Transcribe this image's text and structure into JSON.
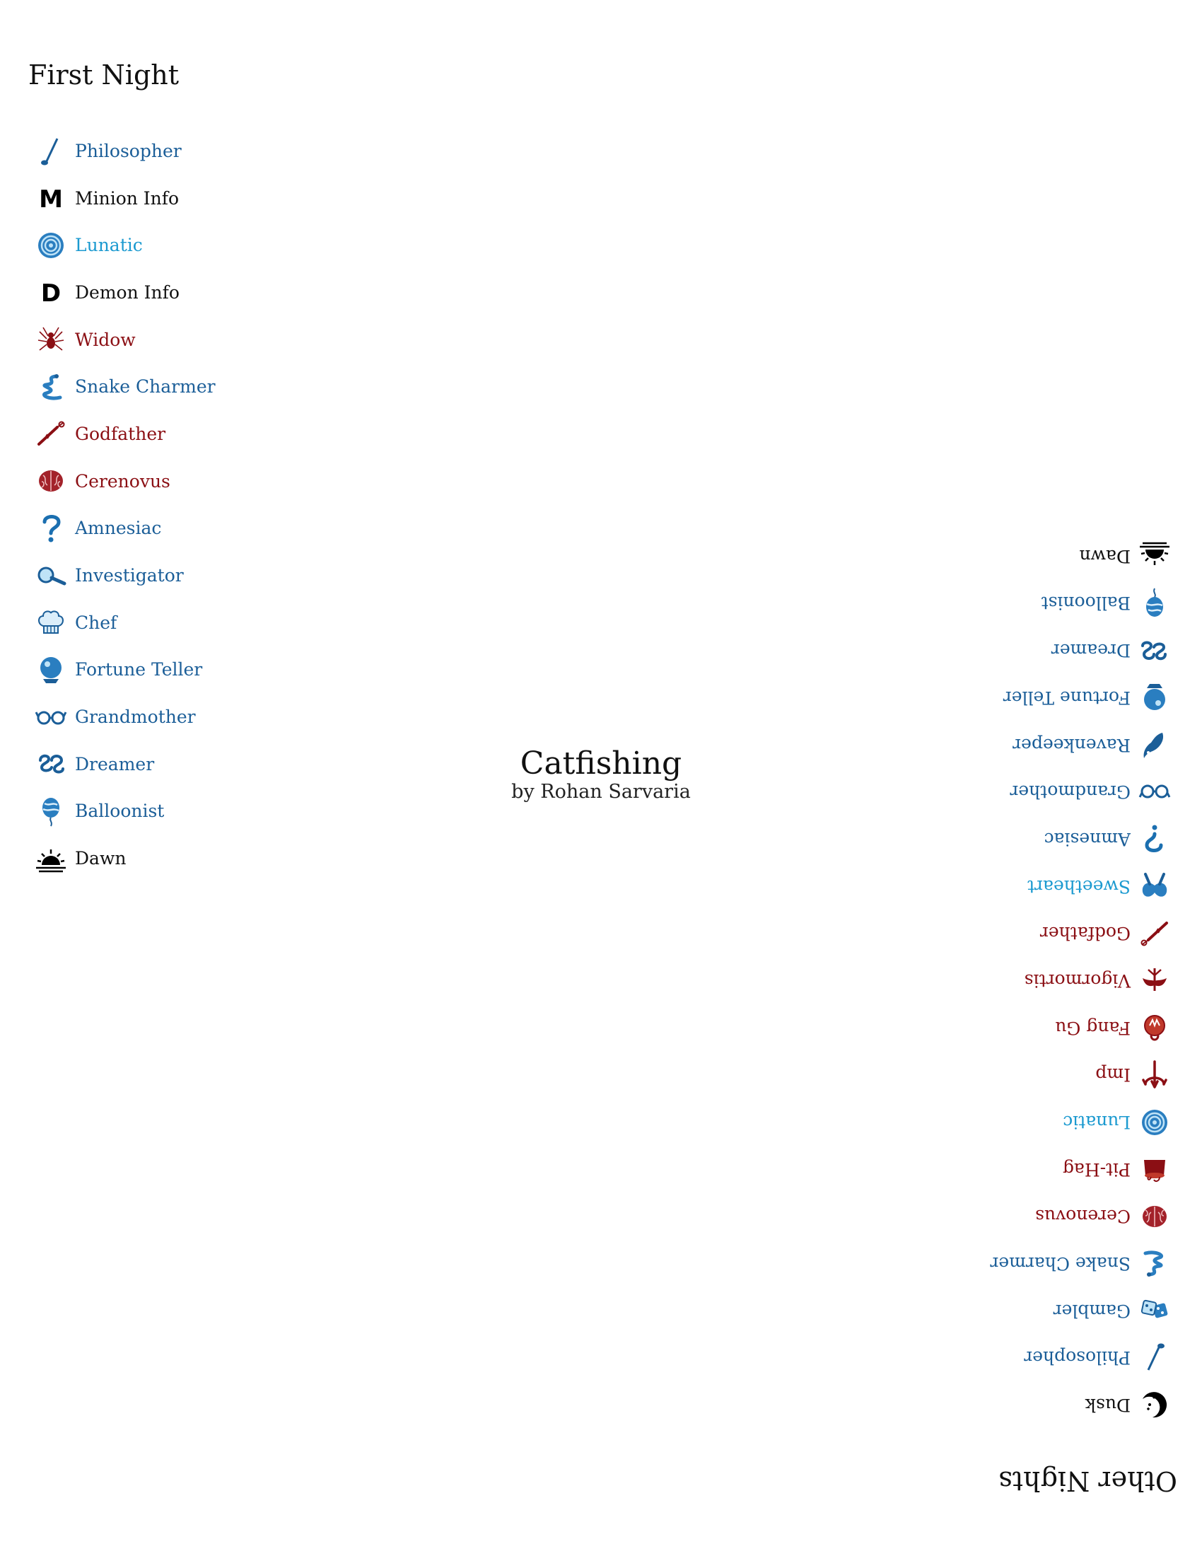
{
  "script": {
    "title": "Catfishing",
    "author": "by Rohan Sarvaria"
  },
  "first_night": {
    "title": "First Night",
    "items": [
      {
        "label": "Philosopher",
        "type": "townsfolk",
        "icon": "philosopher-icon"
      },
      {
        "label": "Minion Info",
        "type": "info",
        "icon": "minion-info-icon"
      },
      {
        "label": "Lunatic",
        "type": "outsider",
        "icon": "lunatic-icon"
      },
      {
        "label": "Demon Info",
        "type": "info",
        "icon": "demon-info-icon"
      },
      {
        "label": "Widow",
        "type": "minion",
        "icon": "widow-icon"
      },
      {
        "label": "Snake Charmer",
        "type": "townsfolk",
        "icon": "snake-charmer-icon"
      },
      {
        "label": "Godfather",
        "type": "minion",
        "icon": "godfather-icon"
      },
      {
        "label": "Cerenovus",
        "type": "minion",
        "icon": "cerenovus-icon"
      },
      {
        "label": "Amnesiac",
        "type": "townsfolk",
        "icon": "amnesiac-icon"
      },
      {
        "label": "Investigator",
        "type": "townsfolk",
        "icon": "investigator-icon"
      },
      {
        "label": "Chef",
        "type": "townsfolk",
        "icon": "chef-icon"
      },
      {
        "label": "Fortune Teller",
        "type": "townsfolk",
        "icon": "fortune-teller-icon"
      },
      {
        "label": "Grandmother",
        "type": "townsfolk",
        "icon": "grandmother-icon"
      },
      {
        "label": "Dreamer",
        "type": "townsfolk",
        "icon": "dreamer-icon"
      },
      {
        "label": "Balloonist",
        "type": "townsfolk",
        "icon": "balloonist-icon"
      },
      {
        "label": "Dawn",
        "type": "info",
        "icon": "dawn-icon"
      }
    ]
  },
  "other_nights": {
    "title": "Other Nights",
    "items": [
      {
        "label": "Dusk",
        "type": "info",
        "icon": "dusk-icon"
      },
      {
        "label": "Philosopher",
        "type": "townsfolk",
        "icon": "philosopher-icon"
      },
      {
        "label": "Gambler",
        "type": "townsfolk",
        "icon": "gambler-icon"
      },
      {
        "label": "Snake Charmer",
        "type": "townsfolk",
        "icon": "snake-charmer-icon"
      },
      {
        "label": "Cerenovus",
        "type": "minion",
        "icon": "cerenovus-icon"
      },
      {
        "label": "Pit-Hag",
        "type": "minion",
        "icon": "pit-hag-icon"
      },
      {
        "label": "Lunatic",
        "type": "outsider",
        "icon": "lunatic-icon"
      },
      {
        "label": "Imp",
        "type": "demon",
        "icon": "imp-icon"
      },
      {
        "label": "Fang Gu",
        "type": "demon",
        "icon": "fang-gu-icon"
      },
      {
        "label": "Vigormortis",
        "type": "demon",
        "icon": "vigormortis-icon"
      },
      {
        "label": "Godfather",
        "type": "minion",
        "icon": "godfather-icon"
      },
      {
        "label": "Sweetheart",
        "type": "outsider",
        "icon": "sweetheart-icon"
      },
      {
        "label": "Amnesiac",
        "type": "townsfolk",
        "icon": "amnesiac-icon"
      },
      {
        "label": "Grandmother",
        "type": "townsfolk",
        "icon": "grandmother-icon"
      },
      {
        "label": "Ravenkeeper",
        "type": "townsfolk",
        "icon": "ravenkeeper-icon"
      },
      {
        "label": "Fortune Teller",
        "type": "townsfolk",
        "icon": "fortune-teller-icon"
      },
      {
        "label": "Dreamer",
        "type": "townsfolk",
        "icon": "dreamer-icon"
      },
      {
        "label": "Balloonist",
        "type": "townsfolk",
        "icon": "balloonist-icon"
      },
      {
        "label": "Dawn",
        "type": "info",
        "icon": "dawn-icon"
      }
    ]
  },
  "colors": {
    "townsfolk": "#1b5e98",
    "outsider": "#1c9ad0",
    "minion": "#8b0f14",
    "demon": "#8b0f14",
    "info": "#111111"
  }
}
